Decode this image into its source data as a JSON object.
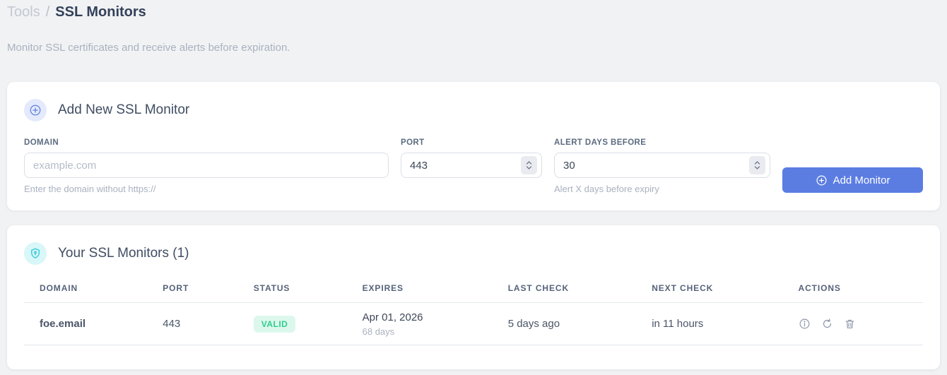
{
  "breadcrumb": {
    "section": "Tools",
    "separator": "/",
    "current": "SSL Monitors"
  },
  "subtitle": "Monitor SSL certificates and receive alerts before expiration.",
  "colors": {
    "accent_blue": "#5b7de2",
    "teal": "#2fc9d6",
    "valid_green": "#2fce8f",
    "valid_green_bg": "#dcf8ec",
    "page_bg": "#f1f2f4"
  },
  "add_monitor": {
    "header_icon": "plus-circle-icon",
    "title": "Add New SSL Monitor",
    "fields": {
      "domain": {
        "label": "DOMAIN",
        "placeholder": "example.com",
        "helper": "Enter the domain without https://"
      },
      "port": {
        "label": "PORT",
        "value": "443"
      },
      "alert_days": {
        "label": "ALERT DAYS BEFORE",
        "value": "30",
        "helper": "Alert X days before expiry"
      }
    },
    "submit": {
      "icon": "plus-circle-icon",
      "label": "Add Monitor"
    }
  },
  "monitors": {
    "header_icon": "shield-lock-icon",
    "title": "Your SSL Monitors (1)",
    "count": 1,
    "table": {
      "headers": [
        "DOMAIN",
        "PORT",
        "STATUS",
        "EXPIRES",
        "LAST CHECK",
        "NEXT CHECK",
        "ACTIONS"
      ],
      "rows": [
        {
          "domain": "foe.email",
          "port": "443",
          "status": "VALID",
          "expires_date": "Apr 01, 2026",
          "expires_days": "68 days",
          "last_check": "5 days ago",
          "next_check": "in 11 hours",
          "actions": [
            "info-icon",
            "refresh-icon",
            "trash-icon"
          ]
        }
      ]
    }
  }
}
